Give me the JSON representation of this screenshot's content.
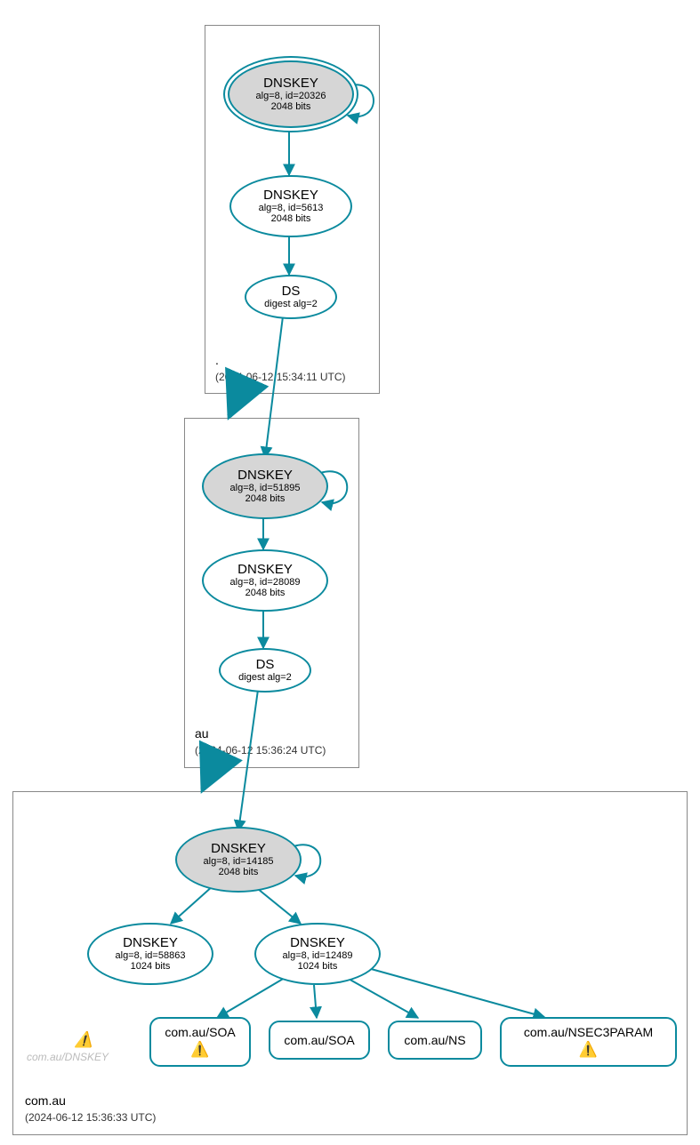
{
  "zones": {
    "root": {
      "name": ".",
      "ts": "(2024-06-12 15:34:11 UTC)"
    },
    "au": {
      "name": "au",
      "ts": "(2024-06-12 15:36:24 UTC)"
    },
    "comau": {
      "name": "com.au",
      "ts": "(2024-06-12 15:36:33 UTC)"
    }
  },
  "nodes": {
    "root_ksk": {
      "l1": "DNSKEY",
      "l2": "alg=8, id=20326",
      "l3": "2048 bits"
    },
    "root_zsk": {
      "l1": "DNSKEY",
      "l2": "alg=8, id=5613",
      "l3": "2048 bits"
    },
    "root_ds": {
      "l1": "DS",
      "l2": "digest alg=2"
    },
    "au_ksk": {
      "l1": "DNSKEY",
      "l2": "alg=8, id=51895",
      "l3": "2048 bits"
    },
    "au_zsk": {
      "l1": "DNSKEY",
      "l2": "alg=8, id=28089",
      "l3": "2048 bits"
    },
    "au_ds": {
      "l1": "DS",
      "l2": "digest alg=2"
    },
    "comau_ksk": {
      "l1": "DNSKEY",
      "l2": "alg=8, id=14185",
      "l3": "2048 bits"
    },
    "comau_zsk1": {
      "l1": "DNSKEY",
      "l2": "alg=8, id=58863",
      "l3": "1024 bits"
    },
    "comau_zsk2": {
      "l1": "DNSKEY",
      "l2": "alg=8, id=12489",
      "l3": "1024 bits"
    }
  },
  "rrsets": {
    "soa1": "com.au/SOA",
    "soa2": "com.au/SOA",
    "ns": "com.au/NS",
    "nsec3": "com.au/NSEC3PARAM"
  },
  "faded": "com.au/DNSKEY",
  "warn_glyph": "⚠️"
}
